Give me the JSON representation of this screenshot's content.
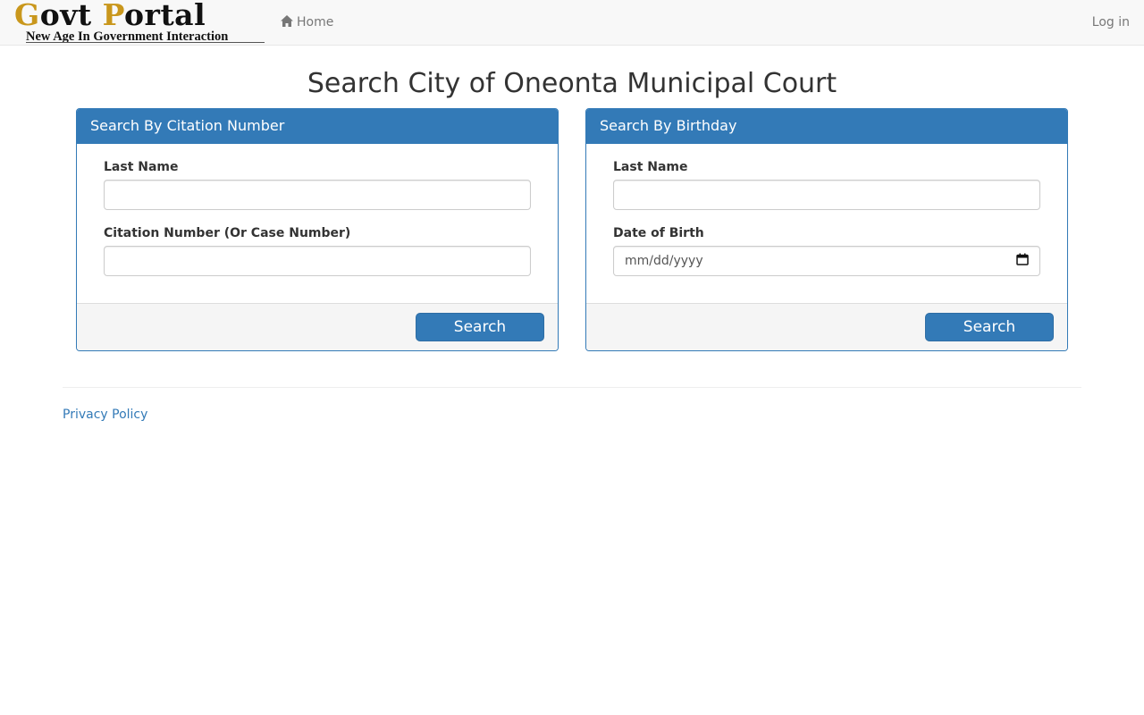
{
  "navbar": {
    "brand": {
      "title_g": "G",
      "title_ovt": "ovt ",
      "title_p": "P",
      "title_ortal": "ortal",
      "tagline": "New Age In Government Interaction"
    },
    "home_label": "Home",
    "home_icon": "home-icon",
    "login_label": "Log in"
  },
  "page": {
    "title": "Search City of Oneonta Municipal Court"
  },
  "citation_panel": {
    "heading": "Search By Citation Number",
    "last_name_label": "Last Name",
    "last_name_value": "",
    "citation_label": "Citation Number (Or Case Number)",
    "citation_value": "",
    "search_label": "Search"
  },
  "birthday_panel": {
    "heading": "Search By Birthday",
    "last_name_label": "Last Name",
    "last_name_value": "",
    "dob_label": "Date of Birth",
    "dob_placeholder": "mm/dd/yyyy",
    "dob_icon": "calendar-icon",
    "search_label": "Search"
  },
  "footer": {
    "privacy_label": "Privacy Policy"
  },
  "colors": {
    "primary": "#337ab7",
    "brand_gold": "#c9971c",
    "navbar_bg": "#f8f8f8",
    "panel_footer_bg": "#f5f5f5"
  }
}
